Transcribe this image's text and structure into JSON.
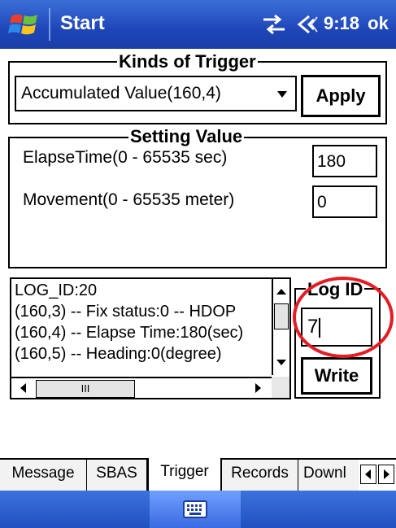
{
  "titlebar": {
    "app_name": "Start",
    "time": "9:18",
    "ok_label": "ok"
  },
  "trigger_kinds": {
    "legend": "Kinds of Trigger",
    "selected": "Accumulated Value(160,4)",
    "apply_label": "Apply"
  },
  "setting_value": {
    "legend": "Setting Value",
    "elapse_label": "ElapseTime(0 - 65535 sec)",
    "elapse_value": "180",
    "movement_label": "Movement(0 - 65535 meter)",
    "movement_value": "0"
  },
  "log": {
    "lines": [
      "LOG_ID:20",
      "(160,3) -- Fix status:0 -- HDOP",
      "(160,4) -- Elapse Time:180(sec)",
      "(160,5) -- Heading:0(degree)"
    ],
    "scroll_thumb_glyph": "III"
  },
  "log_id": {
    "legend": "Log ID",
    "value": "7",
    "write_label": "Write"
  },
  "tabs": [
    {
      "label": "Message",
      "active": false
    },
    {
      "label": "SBAS",
      "active": false
    },
    {
      "label": "Trigger",
      "active": true
    },
    {
      "label": "Records",
      "active": false
    },
    {
      "label": "Downl",
      "active": false
    }
  ],
  "icons": {
    "start": "windows-flag-icon",
    "connectivity": "connectivity-icon",
    "volume": "volume-icon",
    "keyboard": "keyboard-icon"
  },
  "colors": {
    "titlebar": "#1f46b8",
    "highlight_circle": "#e51c23"
  }
}
